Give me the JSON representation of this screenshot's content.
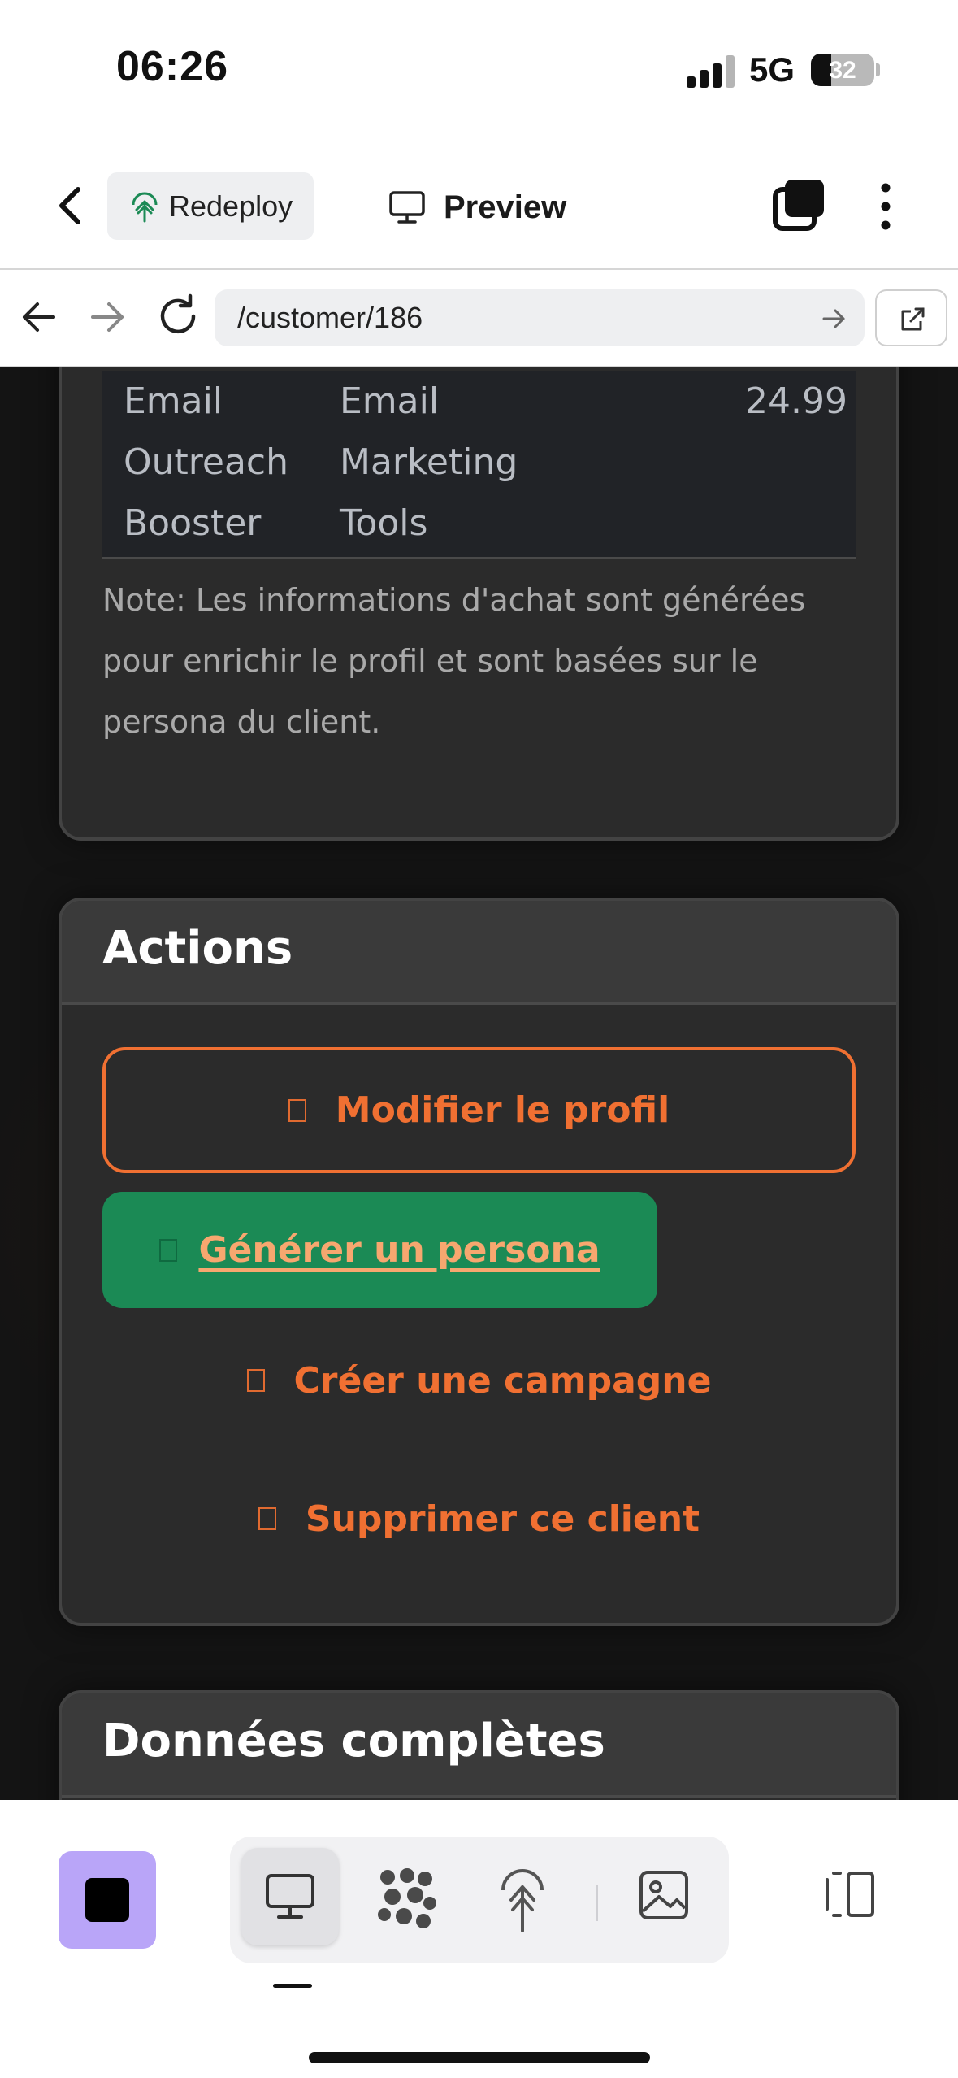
{
  "status": {
    "time": "06:26",
    "network": "5G",
    "battery": "32"
  },
  "toolbar": {
    "redeploy_label": "Redeploy",
    "preview_label": "Preview"
  },
  "browser": {
    "url": "/customer/186"
  },
  "purchase_table": {
    "row": {
      "product": [
        "Email",
        "Outreach",
        "Booster"
      ],
      "category": [
        "Email",
        "Marketing",
        "Tools"
      ],
      "price": "24.99"
    },
    "note": "Note: Les informations d'achat sont générées pour enrichir le profil et sont basées sur le persona du client."
  },
  "actions": {
    "title": "Actions",
    "edit_label": "Modifier le profil",
    "persona_label": "Générer un persona",
    "campaign_label": "Créer une campagne",
    "delete_label": "Supprimer ce client"
  },
  "full_data": {
    "title": "Données complètes"
  },
  "colors": {
    "accent": "#f07032",
    "persona_bg": "#1b8a55",
    "stop_bg": "#b9a5f8"
  }
}
